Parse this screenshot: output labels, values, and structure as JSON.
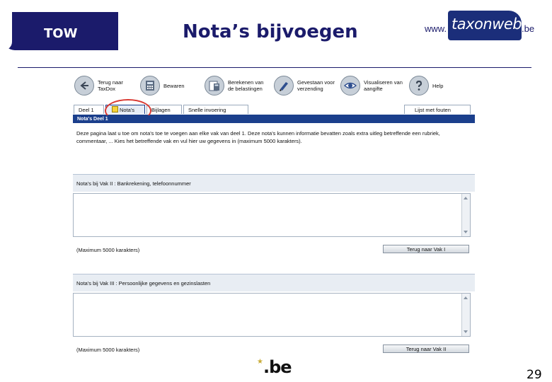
{
  "slide": {
    "tow_label": "TOW",
    "title": "Nota’s bijvoegen",
    "logo": {
      "prefix": "www.",
      "brand": "taxonweb",
      "suffix": ".be"
    },
    "footer_logo": ".be",
    "page_number": "29"
  },
  "toolbar": {
    "items": [
      {
        "icon": "back-arrow-icon",
        "label": "Terug naar TaxDox"
      },
      {
        "icon": "calculator-icon",
        "label": "Bewaren"
      },
      {
        "icon": "calculator-sheet-icon",
        "label": "Berekenen van de belastingen"
      },
      {
        "icon": "pen-icon",
        "label": "Gevestaan voor verzending"
      },
      {
        "icon": "eye-icon",
        "label": "Visualiseren van aangifte"
      },
      {
        "icon": "help-icon",
        "label": "Help"
      }
    ]
  },
  "tabs": {
    "items": [
      "Deel 1",
      "Nota's",
      "Bijlagen",
      "Snelle invoering"
    ],
    "active": "Nota's",
    "right_tab": "Lijst met fouten"
  },
  "section": {
    "bar_label": "Nota's Deel 1",
    "intro": "Deze pagina laat u toe om nota's toe te voegen aan elke vak van deel 1. Deze nota's kunnen informatie bevatten zoals extra uitleg betreffende een rubriek, commentaar, ... Kies het betreffende vak en vul hier uw gegevens in (maximum 5000 karakters)."
  },
  "notes": [
    {
      "header": "Nota's bij  Vak II : Bankrekening, telefoonnummer",
      "max_note": "(Maximum 5000 karakters)",
      "back_button": "Terug naar Vak I"
    },
    {
      "header": "Nota's bij  Vak III : Persoonlijke gegevens en gezinslasten",
      "max_note": "(Maximum 5000 karakters)",
      "back_button": "Terug naar Vak II"
    }
  ],
  "colors": {
    "navy": "#1b1b6b",
    "tab_blue": "#1b3f8c",
    "highlight_circle": "#d93a33"
  }
}
